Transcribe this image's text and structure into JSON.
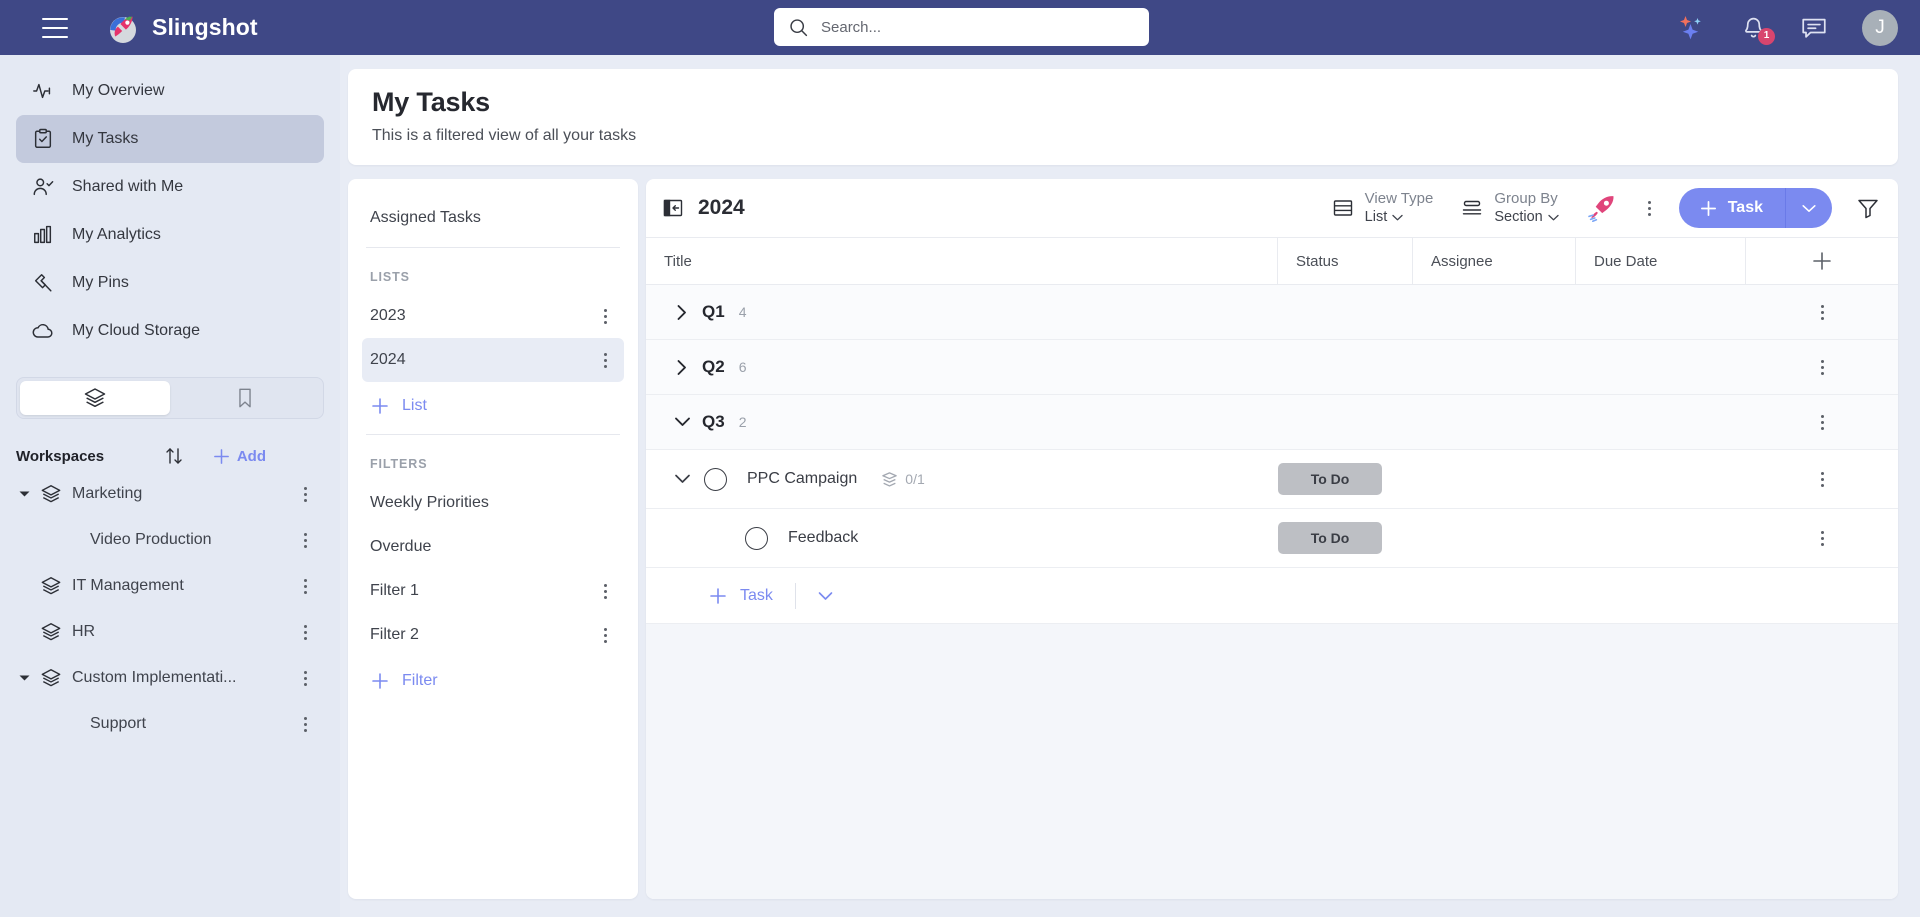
{
  "topbar": {
    "brand": "Slingshot",
    "search_placeholder": "Search...",
    "search_value": "",
    "notification_count": "1",
    "avatar_initial": "J"
  },
  "sidebar": {
    "items": [
      {
        "label": "My Overview",
        "icon": "activity-icon",
        "active": false
      },
      {
        "label": "My Tasks",
        "icon": "clipboard-check-icon",
        "active": true
      },
      {
        "label": "Shared with Me",
        "icon": "user-check-icon",
        "active": false
      },
      {
        "label": "My Analytics",
        "icon": "bar-chart-icon",
        "active": false
      },
      {
        "label": "My Pins",
        "icon": "pin-icon",
        "active": false
      },
      {
        "label": "My Cloud Storage",
        "icon": "cloud-icon",
        "active": false
      }
    ],
    "segments": [
      {
        "icon": "layers-icon",
        "active": true
      },
      {
        "icon": "bookmark-icon",
        "active": false
      }
    ],
    "workspaces_title": "Workspaces",
    "add_label": "Add",
    "workspaces": [
      {
        "label": "Marketing",
        "expanded": true,
        "child": false
      },
      {
        "label": "Video Production",
        "expanded": false,
        "child": true
      },
      {
        "label": "IT Management",
        "expanded": false,
        "child": false
      },
      {
        "label": "HR",
        "expanded": false,
        "child": false
      },
      {
        "label": "Custom Implementati...",
        "expanded": true,
        "child": false
      },
      {
        "label": "Support",
        "expanded": false,
        "child": true
      }
    ]
  },
  "page": {
    "title": "My Tasks",
    "subtitle": "This is a filtered view of all your tasks"
  },
  "listpanel": {
    "assigned_tasks": "Assigned Tasks",
    "lists_header": "LISTS",
    "lists": [
      {
        "label": "2023",
        "selected": false,
        "kebab": true
      },
      {
        "label": "2024",
        "selected": true,
        "kebab": true
      }
    ],
    "add_list_label": "List",
    "filters_header": "FILTERS",
    "filters": [
      {
        "label": "Weekly Priorities",
        "kebab": false
      },
      {
        "label": "Overdue",
        "kebab": false
      },
      {
        "label": "Filter 1",
        "kebab": true
      },
      {
        "label": "Filter 2",
        "kebab": true
      }
    ],
    "add_filter_label": "Filter"
  },
  "toolbar": {
    "list_title": "2024",
    "view_type_label": "View Type",
    "view_type_value": "List",
    "group_by_label": "Group By",
    "group_by_value": "Section",
    "task_button": "Task"
  },
  "table": {
    "columns": [
      "Title",
      "Status",
      "Assignee",
      "Due Date"
    ],
    "groups": [
      {
        "name": "Q1",
        "count": "4",
        "expanded": false,
        "tasks": []
      },
      {
        "name": "Q2",
        "count": "6",
        "expanded": false,
        "tasks": []
      },
      {
        "name": "Q3",
        "count": "2",
        "expanded": true,
        "tasks": [
          {
            "title": "PPC Campaign",
            "status": "To Do",
            "assignee": "",
            "due_date": "",
            "subtask_count": "0/1",
            "expanded": true,
            "child": false,
            "has_caret": true
          },
          {
            "title": "Feedback",
            "status": "To Do",
            "assignee": "",
            "due_date": "",
            "subtask_count": "",
            "expanded": false,
            "child": true,
            "has_caret": false
          }
        ]
      }
    ],
    "add_task_label": "Task"
  },
  "colors": {
    "topbar": "#3f4886",
    "accent": "#7b8af0",
    "sidebar_bg": "#e4e9f3",
    "active_nav": "#c3cadd",
    "status_pill": "#bdbfc4",
    "badge": "#d8456e",
    "rocket": "#e0457b"
  }
}
